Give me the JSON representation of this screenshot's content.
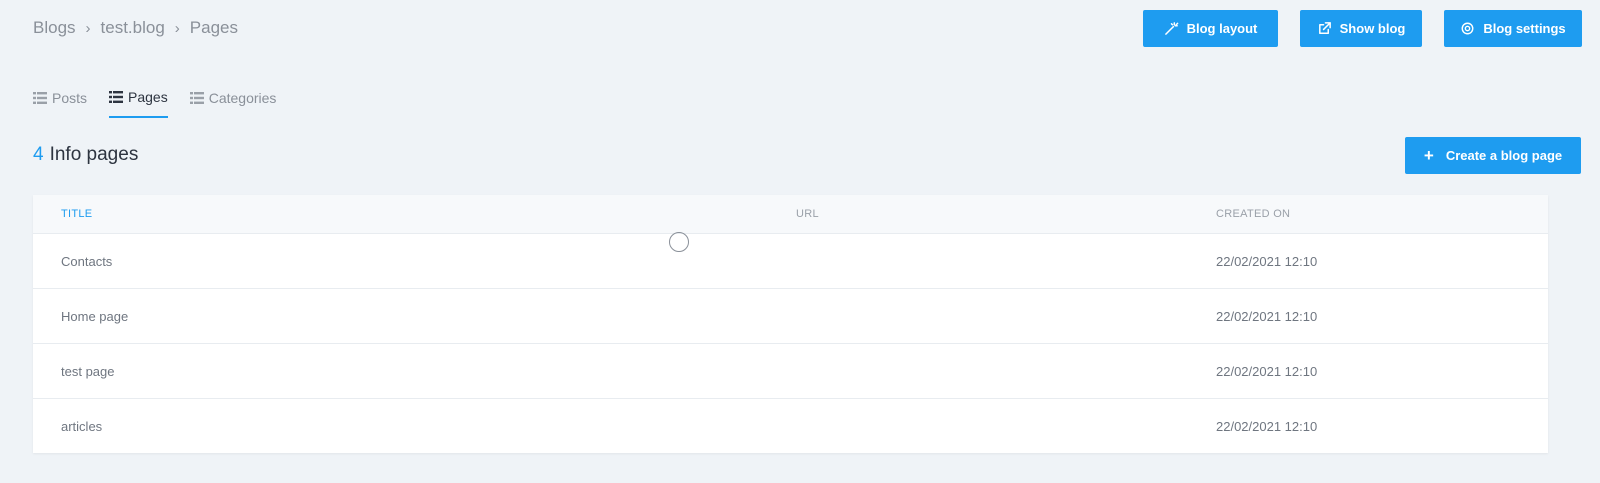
{
  "breadcrumb": {
    "items": [
      "Blogs",
      "test.blog",
      "Pages"
    ]
  },
  "toolbar": {
    "blog_layout": "Blog layout",
    "show_blog": "Show blog",
    "blog_settings": "Blog settings"
  },
  "tabs": [
    {
      "label": "Posts",
      "active": false
    },
    {
      "label": "Pages",
      "active": true
    },
    {
      "label": "Categories",
      "active": false
    }
  ],
  "section": {
    "count": "4",
    "title": "Info pages",
    "create_button": "Create a blog page"
  },
  "table": {
    "columns": [
      "TITLE",
      "URL",
      "CREATED ON"
    ],
    "rows": [
      {
        "title": "Contacts",
        "url": "",
        "created": "22/02/2021 12:10"
      },
      {
        "title": "Home page",
        "url": "",
        "created": "22/02/2021 12:10"
      },
      {
        "title": "test page",
        "url": "",
        "created": "22/02/2021 12:10"
      },
      {
        "title": "articles",
        "url": "",
        "created": "22/02/2021 12:10"
      }
    ]
  },
  "colors": {
    "accent": "#1e9cf0",
    "background": "#eff3f7"
  }
}
